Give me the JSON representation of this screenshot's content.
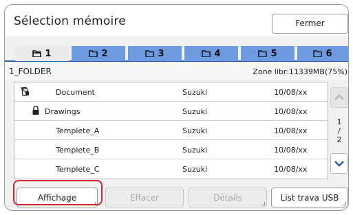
{
  "window": {
    "title": "Sélection mémoire",
    "close_label": "Fermer"
  },
  "tabs": [
    {
      "label": "1",
      "active": true
    },
    {
      "label": "2",
      "active": false
    },
    {
      "label": "3",
      "active": false
    },
    {
      "label": "4",
      "active": false
    },
    {
      "label": "5",
      "active": false
    },
    {
      "label": "6",
      "active": false
    }
  ],
  "folder": {
    "name": "1_FOLDER",
    "free_space": "Zone libr:11339MB(75%)"
  },
  "files": [
    {
      "icon": "lock-trash-icon",
      "name": "Document",
      "owner": "Suzuki",
      "date": "10/08/xx"
    },
    {
      "icon": "lock-icon",
      "name": "Drawings",
      "owner": "Suzuki",
      "date": "10/08/xx"
    },
    {
      "icon": "",
      "name": "Templete_A",
      "owner": "Suzuki",
      "date": "10/08/xx"
    },
    {
      "icon": "",
      "name": "Templete_B",
      "owner": "Suzuki",
      "date": "10/08/xx"
    },
    {
      "icon": "",
      "name": "Templete_C",
      "owner": "Suzuki",
      "date": "10/08/xx"
    }
  ],
  "pagination": {
    "current": "1",
    "separator": "/",
    "total": "2"
  },
  "footer": {
    "view_label": "Affichage",
    "delete_label": "Effacer",
    "details_label": "Détails",
    "usb_label": "List trava USB"
  },
  "colors": {
    "tab_blue": "#6d9ae0",
    "tab_underline": "#2d5da8",
    "highlight": "#d0282f",
    "scroll_arrow": "#2a5fb0"
  }
}
